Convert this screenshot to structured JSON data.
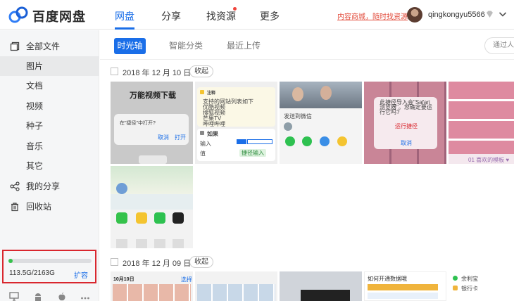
{
  "app": {
    "name": "百度网盘"
  },
  "nav": {
    "items": [
      "网盘",
      "分享",
      "找资源",
      "更多"
    ]
  },
  "header": {
    "promo": "内容商城，随时找资源",
    "username": "qingkongyu5566"
  },
  "sidebar": {
    "items": [
      "全部文件",
      "图片",
      "文档",
      "视频",
      "种子",
      "音乐",
      "其它",
      "我的分享",
      "回收站"
    ],
    "quota": {
      "text": "113.5G/2163G",
      "expand": "扩容",
      "used_fraction": 0.052
    }
  },
  "tabs": {
    "items": [
      "时光轴",
      "智能分类",
      "最近上传"
    ],
    "search_text": "通过人物、地点搜索"
  },
  "groups": [
    {
      "date": "2018 年 12 月 10 日",
      "collapse": "收起"
    },
    {
      "date": "2018 年 12 月 09 日",
      "collapse": "收起"
    }
  ],
  "thumbs": {
    "t1": {
      "title": "万能视频下载",
      "prompt": "在\"捷径\"中打开?",
      "cancel": "取消",
      "open": "打开"
    },
    "t2": {
      "title": "注释",
      "lines": [
        "支持的网站列表如下",
        "优酷视频",
        "搜狐视频",
        "芒果TV",
        "哔哩哔哩"
      ],
      "section": "如果",
      "input": "输入",
      "value": "值",
      "chip": "捷径输入"
    },
    "t3": {
      "label": "发送到微信"
    },
    "t4": {
      "dialog": "此捷径导入会\"Safari 浏览器\"。您确定要运行它吗?",
      "run": "运行捷径",
      "cancel": "取消"
    },
    "t5": {
      "caption": "01 喜欢的模板 ♥"
    },
    "t7": {
      "date": "10月10日",
      "select": "选择"
    },
    "t9": {
      "label": "如何开通数据哦"
    },
    "t10": {
      "items": [
        "余利宝",
        "银行卡"
      ]
    }
  },
  "colors": {
    "accent": "#1a6ee8",
    "promo": "#e24b3b",
    "highlight_border": "#d9272e",
    "quota_fill": "#35c24b"
  }
}
